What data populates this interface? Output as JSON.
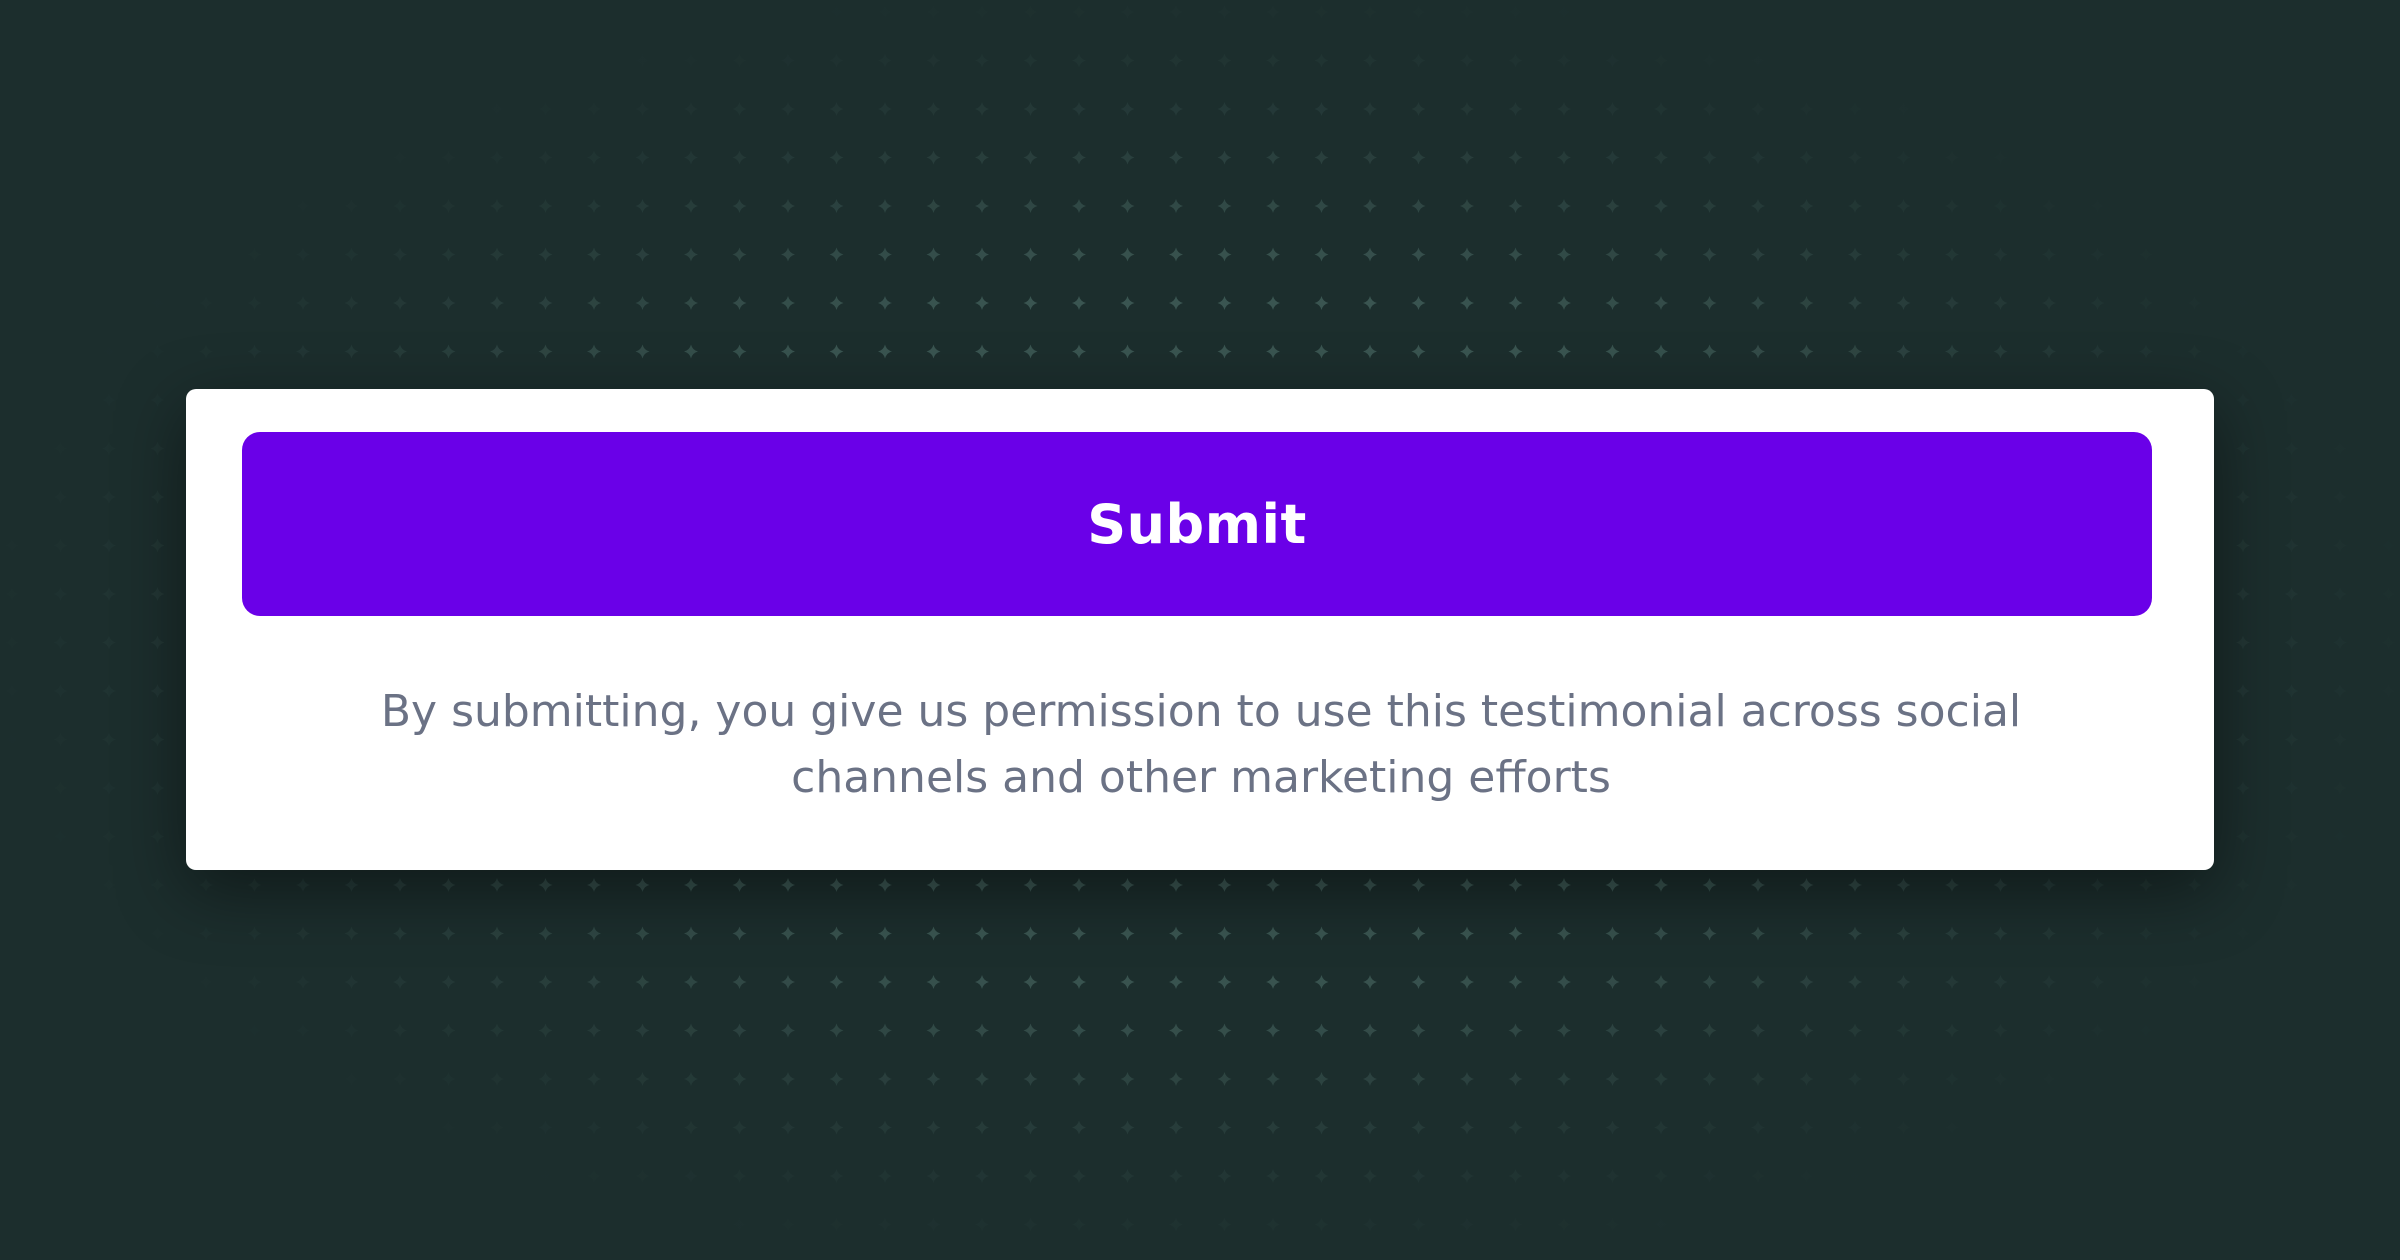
{
  "theme": {
    "background": "#1c2e2d",
    "pattern_color": "#3a5551",
    "card_background": "#ffffff",
    "accent": "#6a00e8",
    "text_muted": "#6b7285"
  },
  "form": {
    "submit_label": "Submit",
    "consent_text": "By submitting, you give us permission to use this testimonial across social channels and other marketing efforts"
  },
  "icons": {
    "background_pattern": "sparkle-icon"
  }
}
